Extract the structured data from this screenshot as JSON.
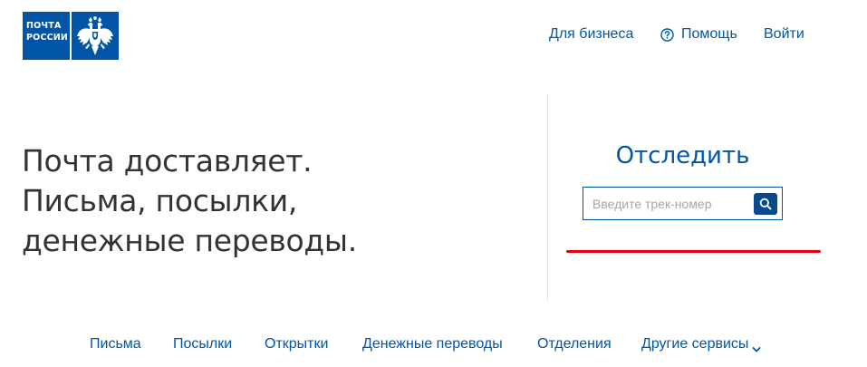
{
  "logo": {
    "text_line1": "ПОЧТА",
    "text_line2": "РОССИИ",
    "emblem_icon": "double-headed-eagle-icon",
    "brand_color": "#0055a6"
  },
  "header": {
    "links": {
      "business": "Для бизнеса",
      "help": "Помощь",
      "login": "Войти"
    },
    "help_icon": "question-circle-icon"
  },
  "hero": {
    "line1": "Почта доставляет.",
    "line2": "Письма, посылки,",
    "line3": "денежные переводы."
  },
  "tracking": {
    "title": "Отследить",
    "input_placeholder": "Введите трек-номер",
    "input_value": "",
    "search_icon": "search-icon",
    "underline_color": "#e00014"
  },
  "bottom_nav": {
    "letters": "Письма",
    "parcels": "Посылки",
    "postcards": "Открытки",
    "money_transfers": "Денежные переводы",
    "offices": "Отделения",
    "other_services": "Другие сервисы",
    "other_services_icon": "chevron-down-icon"
  }
}
